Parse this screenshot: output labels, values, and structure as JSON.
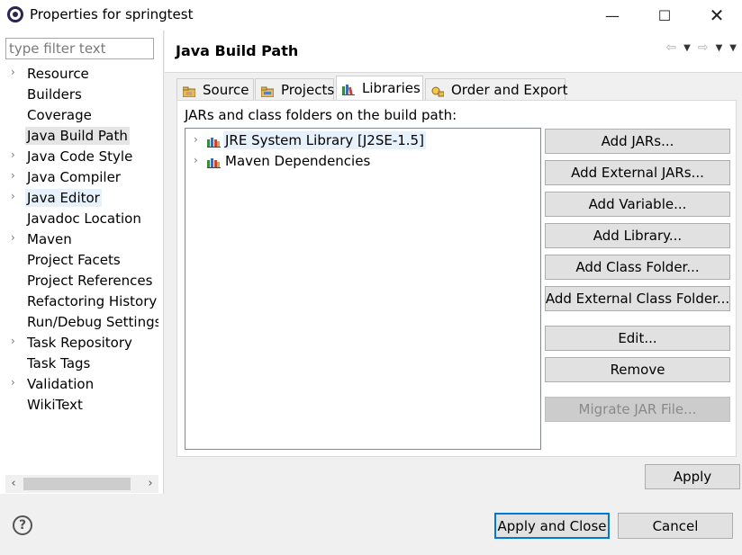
{
  "window": {
    "title": "Properties for springtest"
  },
  "filter": {
    "placeholder": "type filter text",
    "value": ""
  },
  "nav_items": [
    {
      "label": "Resource",
      "expandable": true
    },
    {
      "label": "Builders",
      "expandable": false
    },
    {
      "label": "Coverage",
      "expandable": false
    },
    {
      "label": "Java Build Path",
      "expandable": false,
      "state": "selected"
    },
    {
      "label": "Java Code Style",
      "expandable": true
    },
    {
      "label": "Java Compiler",
      "expandable": true
    },
    {
      "label": "Java Editor",
      "expandable": true,
      "state": "highlight"
    },
    {
      "label": "Javadoc Location",
      "expandable": false
    },
    {
      "label": "Maven",
      "expandable": true
    },
    {
      "label": "Project Facets",
      "expandable": false
    },
    {
      "label": "Project References",
      "expandable": false
    },
    {
      "label": "Refactoring History",
      "expandable": false
    },
    {
      "label": "Run/Debug Settings",
      "expandable": false
    },
    {
      "label": "Task Repository",
      "expandable": true
    },
    {
      "label": "Task Tags",
      "expandable": false
    },
    {
      "label": "Validation",
      "expandable": true
    },
    {
      "label": "WikiText",
      "expandable": false
    }
  ],
  "page": {
    "title": "Java Build Path"
  },
  "tabs": [
    {
      "label": "Source",
      "icon": "source-folder-icon"
    },
    {
      "label": "Projects",
      "icon": "projects-folder-icon"
    },
    {
      "label": "Libraries",
      "icon": "library-icon",
      "active": true
    },
    {
      "label": "Order and Export",
      "icon": "order-export-icon"
    }
  ],
  "libraries": {
    "label": "JARs and class folders on the build path:",
    "entries": [
      {
        "label": "JRE System Library [J2SE-1.5]",
        "selected": true
      },
      {
        "label": "Maven Dependencies",
        "selected": false
      }
    ]
  },
  "buttons": {
    "add_jars": "Add JARs...",
    "add_external_jars": "Add External JARs...",
    "add_variable": "Add Variable...",
    "add_library": "Add Library...",
    "add_class_folder": "Add Class Folder...",
    "add_external_class_folder": "Add External Class Folder...",
    "edit": "Edit...",
    "remove": "Remove",
    "migrate_jar": "Migrate JAR File...",
    "apply": "Apply",
    "apply_and_close": "Apply and Close",
    "cancel": "Cancel"
  },
  "help": {
    "glyph": "?"
  },
  "colors": {
    "accent": "#0078d7",
    "selection": "#e7f1fb",
    "disabled_text": "#8a8a8a"
  }
}
